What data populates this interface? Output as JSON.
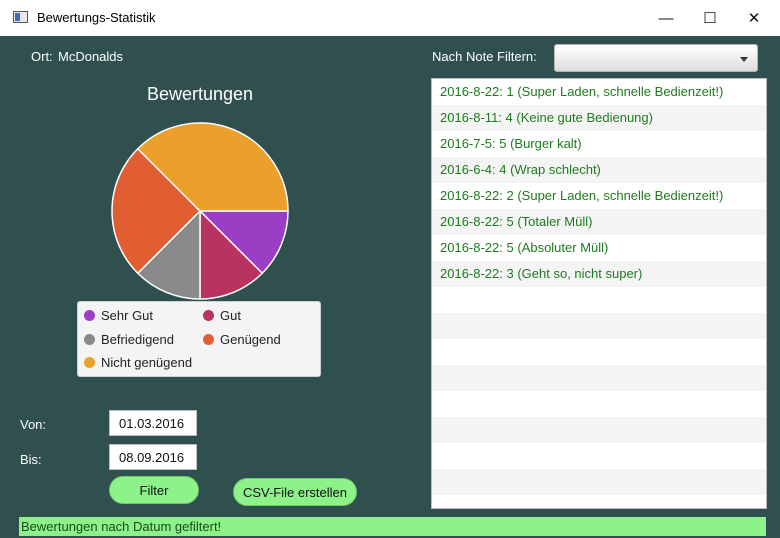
{
  "window": {
    "title": "Bewertungs-Statistik",
    "minimize": "—",
    "maximize": "☐",
    "close": "✕"
  },
  "location": {
    "label": "Ort:",
    "value": "McDonalds"
  },
  "filter": {
    "label": "Nach Note Filtern:",
    "selected": ""
  },
  "chart_data": {
    "type": "pie",
    "title": "Bewertungen",
    "series": [
      {
        "name": "Sehr Gut",
        "value": 1,
        "color": "#9a3fc4"
      },
      {
        "name": "Gut",
        "value": 1,
        "color": "#b8345e"
      },
      {
        "name": "Befriedigend",
        "value": 1,
        "color": "#8a8a8a"
      },
      {
        "name": "Genügend",
        "value": 2,
        "color": "#e05e32"
      },
      {
        "name": "Nicht genügend",
        "value": 3,
        "color": "#eaa02a"
      }
    ],
    "legend_position": "bottom"
  },
  "dates": {
    "from_label": "Von:",
    "from_value": "01.03.2016",
    "to_label": "Bis:",
    "to_value": "08.09.2016"
  },
  "buttons": {
    "filter": "Filter",
    "csv": "CSV-File erstellen"
  },
  "ratings": [
    "2016-8-22: 1 (Super Laden, schnelle Bedienzeit!)",
    "2016-8-11: 4 (Keine gute Bedienung)",
    "2016-7-5: 5 (Burger kalt)",
    "2016-6-4: 4 (Wrap schlecht)",
    "2016-8-22: 2 (Super Laden, schnelle Bedienzeit!)",
    "2016-8-22: 5 (Totaler Müll)",
    "2016-8-22: 5 (Absoluter Müll)",
    "2016-8-22: 3 (Geht so, nicht super)",
    "",
    "",
    "",
    "",
    "",
    "",
    "",
    ""
  ],
  "status": "Bewertungen nach Datum gefiltert!"
}
